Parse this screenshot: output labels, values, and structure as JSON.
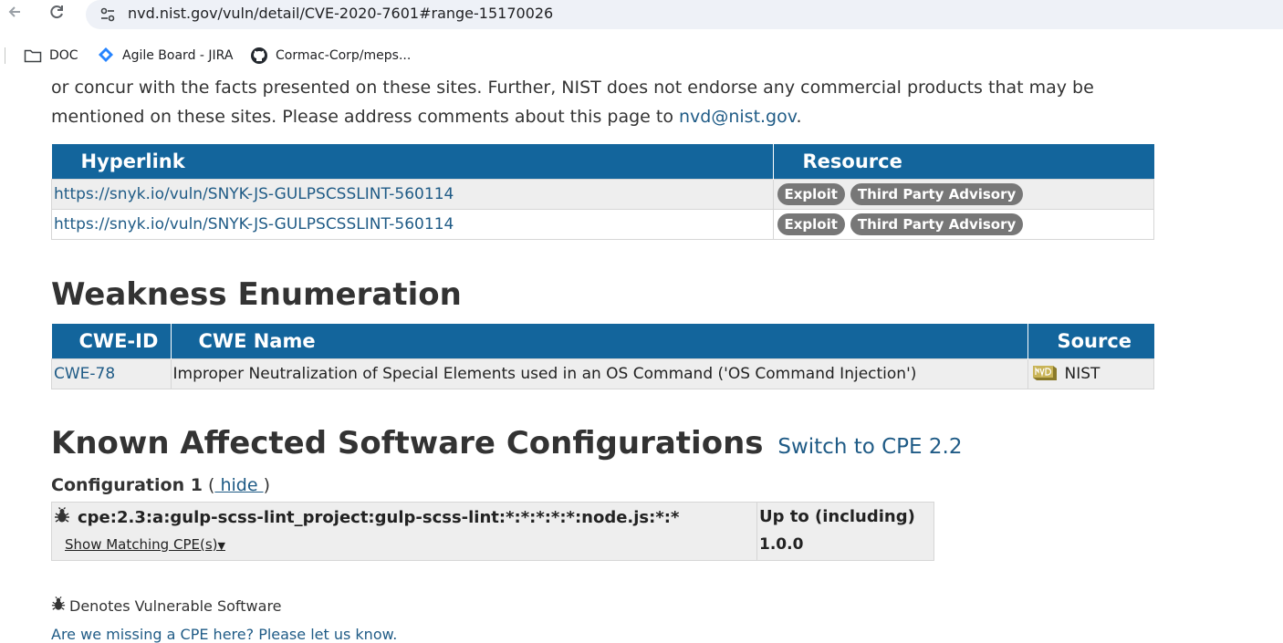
{
  "browser": {
    "url": "nvd.nist.gov/vuln/detail/CVE-2020-7601#range-15170026",
    "bookmarks": [
      {
        "label": "DOC",
        "icon": "folder-icon"
      },
      {
        "label": "Agile Board - JIRA",
        "icon": "jira-icon"
      },
      {
        "label": "Cormac-Corp/meps...",
        "icon": "github-icon"
      }
    ]
  },
  "intro": {
    "text": "or concur with the facts presented on these sites. Further, NIST does not endorse any commercial products that may be mentioned on these sites. Please address comments about this page to ",
    "email": "nvd@nist.gov",
    "end": "."
  },
  "references": {
    "headers": {
      "hyperlink": "Hyperlink",
      "resource": "Resource"
    },
    "rows": [
      {
        "url": "https://snyk.io/vuln/SNYK-JS-GULPSCSSLINT-560114",
        "tags": [
          "Exploit",
          "Third Party Advisory"
        ]
      },
      {
        "url": "https://snyk.io/vuln/SNYK-JS-GULPSCSSLINT-560114",
        "tags": [
          "Exploit",
          "Third Party Advisory"
        ]
      }
    ]
  },
  "weakness": {
    "title": "Weakness Enumeration",
    "headers": {
      "id": "CWE-ID",
      "name": "CWE Name",
      "source": "Source"
    },
    "rows": [
      {
        "id": "CWE-78",
        "name": "Improper Neutralization of Special Elements used in an OS Command ('OS Command Injection')",
        "source": "NIST",
        "source_icon": "nvd-icon"
      }
    ]
  },
  "configs": {
    "title": "Known Affected Software Configurations",
    "switch_link": "Switch to CPE 2.2",
    "config_label": "Configuration 1",
    "paren_open": "(",
    "hide_link": " hide ",
    "paren_close": ")",
    "cpe": "cpe:2.3:a:gulp-scss-lint_project:gulp-scss-lint:*:*:*:*:*:node.js:*:*",
    "show_matching": "Show Matching CPE(s)",
    "upto_label": "Up to (including)",
    "upto_value": "1.0.0",
    "legend": "Denotes Vulnerable Software",
    "missing_link": "Are we missing a CPE here? Please let us know."
  },
  "colors": {
    "header_blue": "#13659c",
    "link": "#1f5b86",
    "badge": "#777777"
  }
}
